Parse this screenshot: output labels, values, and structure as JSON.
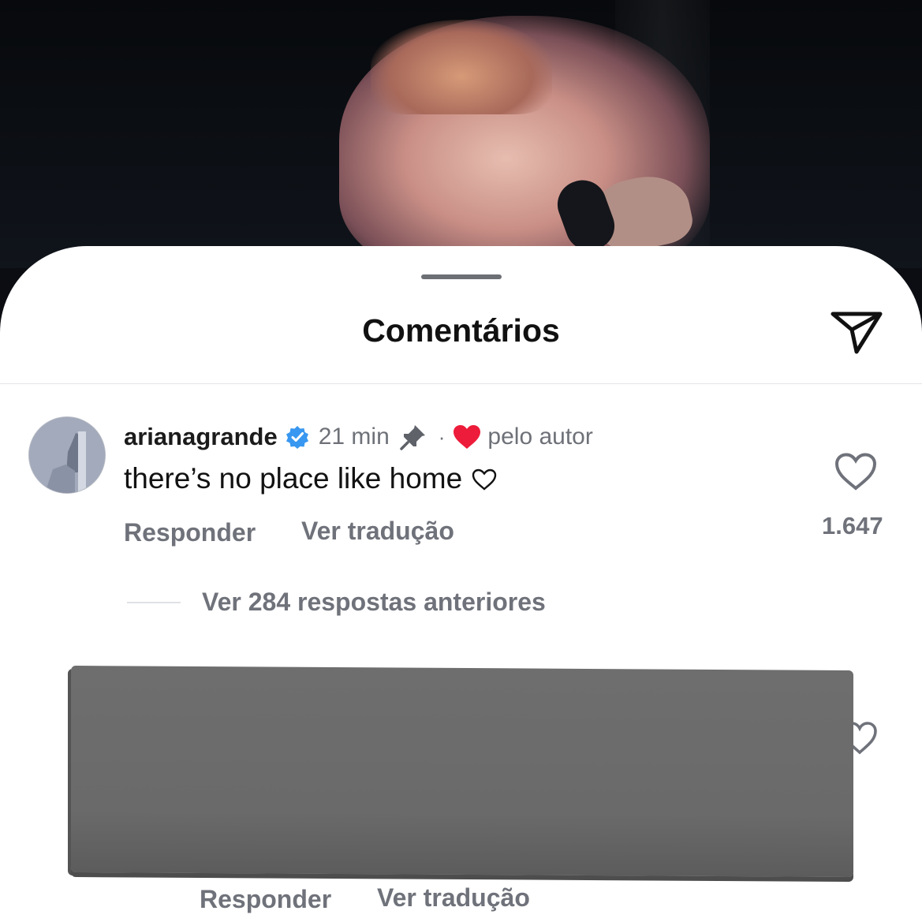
{
  "header": {
    "title": "Comentários",
    "share_icon": "send-paper-plane-icon"
  },
  "comment": {
    "username": "arianagrande",
    "verified": true,
    "time": "21 min",
    "separator": "·",
    "liked_by_author_label": "pelo autor",
    "text": "there’s no place like home",
    "reply_label": "Responder",
    "translate_label": "Ver tradução",
    "like_count": "1.647",
    "accent_heart_color": "#ed1c3a",
    "verified_color": "#3897f0"
  },
  "replies": {
    "view_previous_label": "Ver 284 respostas anteriores"
  },
  "reply_comment": {
    "reply_label": "Responder",
    "translate_label": "Ver tradução"
  }
}
